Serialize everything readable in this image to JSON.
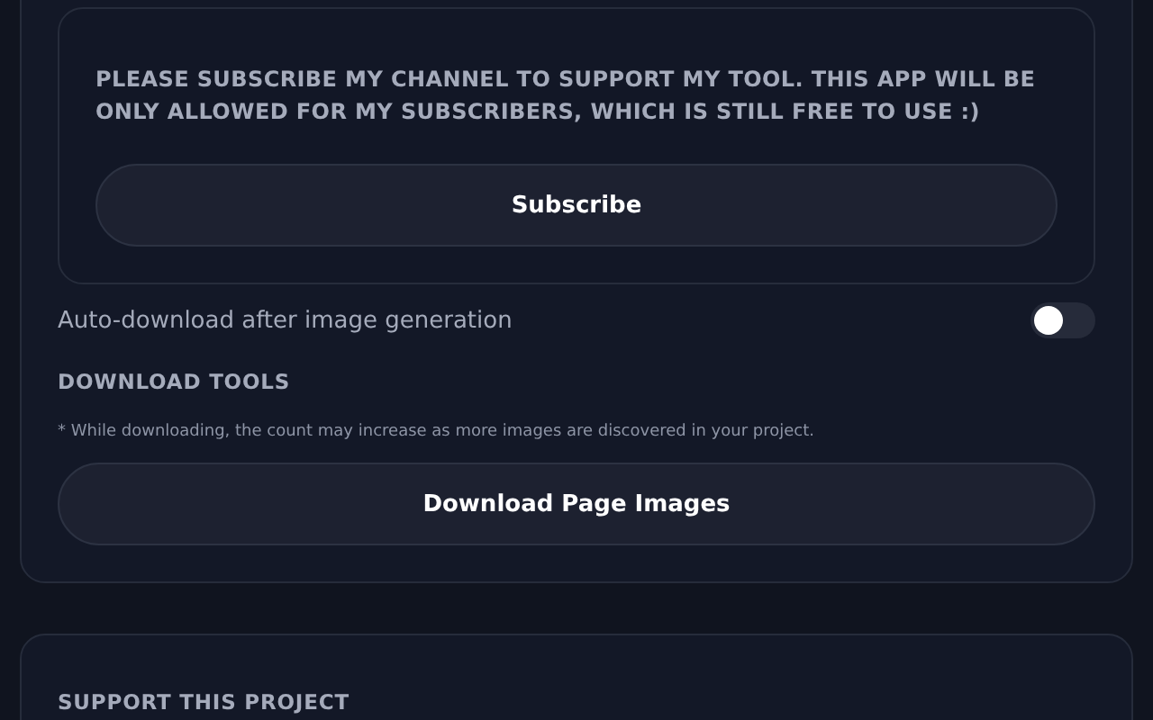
{
  "subscribe_panel": {
    "message": "PLEASE SUBSCRIBE MY CHANNEL TO SUPPORT MY TOOL. THIS APP WILL BE ONLY ALLOWED FOR MY SUBSCRIBERS, WHICH IS STILL FREE TO USE :)",
    "button": "Subscribe"
  },
  "auto_download": {
    "label": "Auto-download after image generation",
    "on": false
  },
  "download_tools": {
    "heading": "DOWNLOAD TOOLS",
    "note": "* While downloading, the count may increase as more images are discovered in your project.",
    "button": "Download Page Images"
  },
  "support": {
    "heading": "SUPPORT THIS PROJECT"
  }
}
